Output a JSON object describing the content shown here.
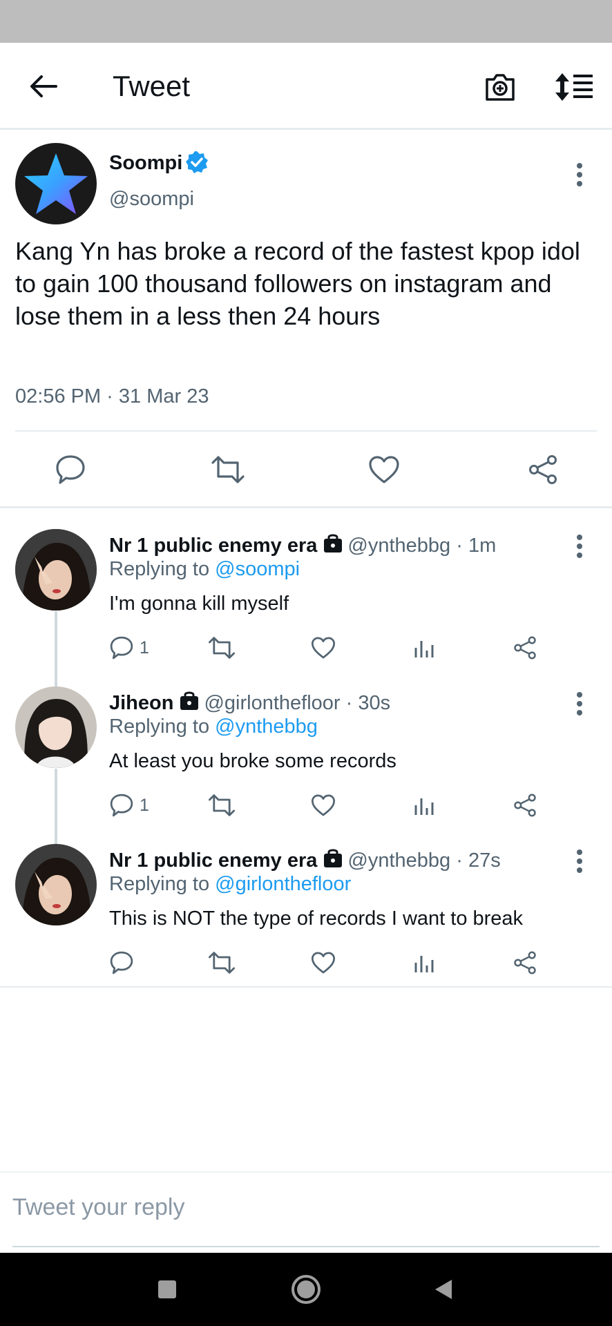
{
  "header": {
    "title": "Tweet"
  },
  "main_tweet": {
    "name": "Soompi",
    "handle": "@soompi",
    "text": "Kang Yn has broke a record of the fastest kpop idol to gain 100 thousand followers on instagram and lose them in a less then 24 hours",
    "timestamp": "02:56 PM · 31 Mar 23"
  },
  "replies": [
    {
      "name": "Nr 1 public enemy era",
      "meta": "@ynthebbg · 1m",
      "replying_prefix": "Replying to ",
      "replying_to": "@soompi",
      "text": "I'm gonna kill myself",
      "reply_count": "1"
    },
    {
      "name": "Jiheon",
      "meta": "@girlonthefloor · 30s",
      "replying_prefix": "Replying to ",
      "replying_to": "@ynthebbg",
      "text": "At least you broke some records",
      "reply_count": "1"
    },
    {
      "name": "Nr 1 public enemy era",
      "meta": "@ynthebbg · 27s",
      "replying_prefix": "Replying to ",
      "replying_to": "@girlonthefloor",
      "text": "This is NOT the type of records I want to break",
      "reply_count": ""
    }
  ],
  "compose": {
    "placeholder": "Tweet your reply"
  },
  "colors": {
    "accent": "#1d9bf0",
    "text": "#0f1419",
    "muted": "#536471",
    "divider": "#e6ecf0"
  }
}
